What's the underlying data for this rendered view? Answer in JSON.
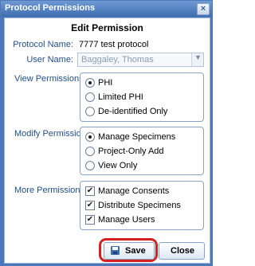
{
  "window": {
    "title": "Protocol Permissions",
    "close_glyph": "×"
  },
  "heading": "Edit Permission",
  "protocol": {
    "label": "Protocol Name:",
    "value": "7777 test protocol"
  },
  "user": {
    "label": "User Name:",
    "value": "Baggaley, Thomas"
  },
  "view_permissions": {
    "label": "View Permissions:",
    "options": [
      "PHI",
      "Limited PHI",
      "De-identified Only"
    ],
    "selected": "PHI"
  },
  "modify_permissions": {
    "label": "Modify Permissions:",
    "options": [
      "Manage Specimens",
      "Project-Only Add",
      "View Only"
    ],
    "selected": "Manage Specimens"
  },
  "more_permissions": {
    "label": "More Permissions:",
    "options": [
      "Manage Consents",
      "Distribute Specimens",
      "Manage Users"
    ],
    "checked": [
      true,
      true,
      true
    ]
  },
  "buttons": {
    "save": "Save",
    "close": "Close"
  },
  "colors": {
    "highlight": "#d42020",
    "title_bar": "#4a78b9"
  }
}
